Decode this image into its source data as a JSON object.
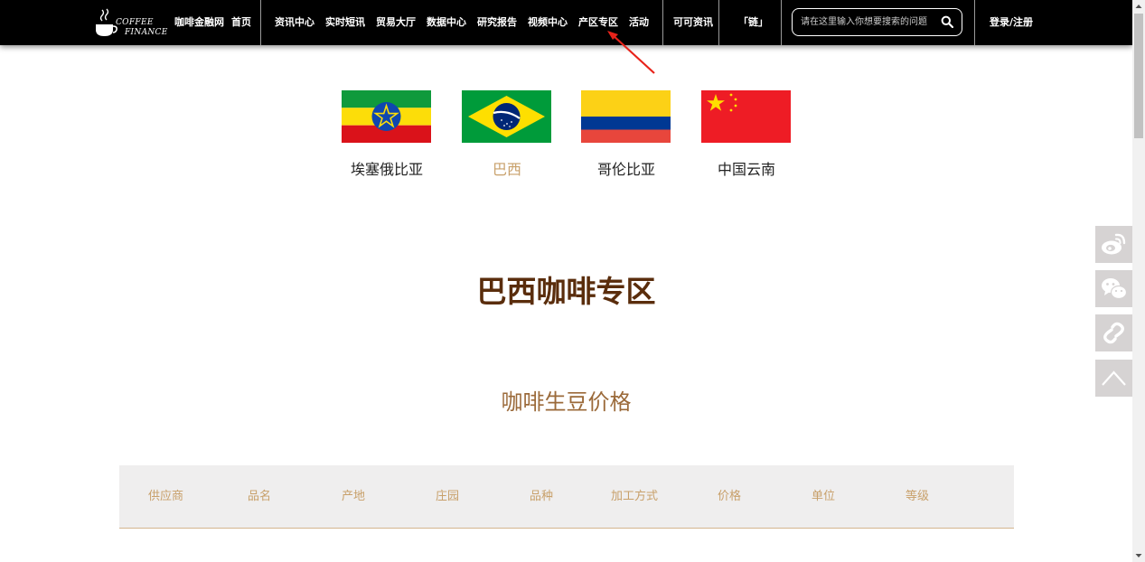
{
  "header": {
    "logo_line1": "COFFEE",
    "logo_line2": "FINANCE",
    "site_name": "咖啡金融网",
    "nav": [
      {
        "label": "首页"
      },
      {
        "label": "资讯中心"
      },
      {
        "label": "实时短讯"
      },
      {
        "label": "贸易大厅"
      },
      {
        "label": "数据中心"
      },
      {
        "label": "研究报告"
      },
      {
        "label": "视频中心"
      },
      {
        "label": "产区专区"
      },
      {
        "label": "活动"
      },
      {
        "label": "可可资讯"
      },
      {
        "label": "「链」"
      }
    ],
    "search": {
      "placeholder": "请在这里输入你想要搜索的问题",
      "icon": "search-icon"
    },
    "login": "登录/注册",
    "background": "#000000"
  },
  "regions": [
    {
      "label": "埃塞俄比亚",
      "flag": "ethiopia-flag",
      "active": false
    },
    {
      "label": "巴西",
      "flag": "brazil-flag",
      "active": true
    },
    {
      "label": "哥伦比亚",
      "flag": "colombia-flag",
      "active": false
    },
    {
      "label": "中国云南",
      "flag": "china-flag",
      "active": false
    }
  ],
  "page_title": "巴西咖啡专区",
  "section_title": "咖啡生豆价格",
  "table": {
    "columns": [
      "供应商",
      "品名",
      "产地",
      "庄园",
      "品种",
      "加工方式",
      "价格",
      "单位",
      "等级"
    ]
  },
  "floating_bar": [
    {
      "icon": "weibo-icon"
    },
    {
      "icon": "wechat-icon"
    },
    {
      "icon": "link-icon"
    },
    {
      "icon": "back-to-top-icon"
    }
  ],
  "colors": {
    "accent": "#c8a06a",
    "title_brown": "#5a2d0c",
    "section_brown": "#9b6a3a",
    "annotation_red": "#e8231a"
  }
}
